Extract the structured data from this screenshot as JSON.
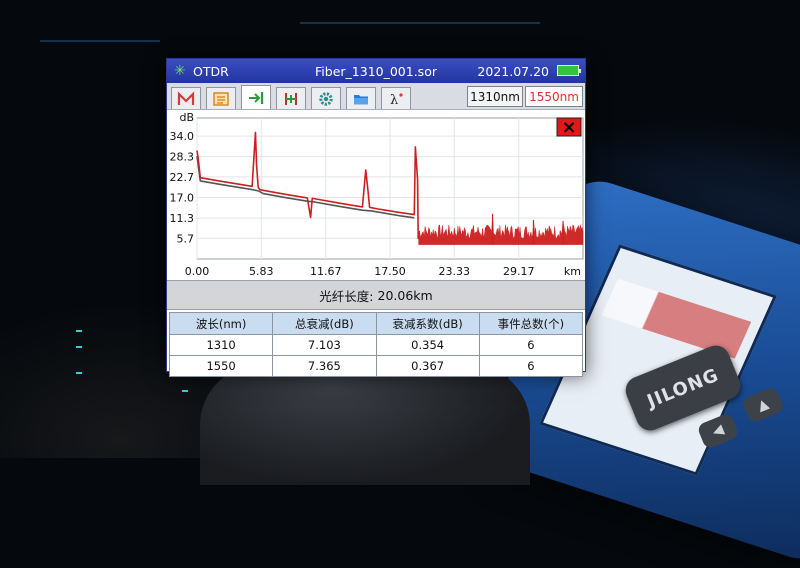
{
  "window": {
    "app_name": "OTDR",
    "file_name": "Fiber_1310_001.sor",
    "date": "2021.07.20",
    "battery_color": "#35c43a",
    "app_icon": "sun-star-icon"
  },
  "toolbar": {
    "tools": [
      {
        "name": "marker-m-icon",
        "color": "#d63a3a"
      },
      {
        "name": "event-list-icon",
        "color": "#d98a1e"
      },
      {
        "name": "arrow-bar-icon",
        "color": "#2c9a3c"
      },
      {
        "name": "cursor-bars-icon",
        "color": "#c03030"
      },
      {
        "name": "settings-gear-icon",
        "color": "#2c8c8c"
      },
      {
        "name": "folder-icon",
        "color": "#2b7bd0"
      },
      {
        "name": "lambda-icon",
        "color": "#222222"
      }
    ],
    "active_tool_index": 2,
    "wavelength_1": "1310nm",
    "wavelength_2": "1550nm",
    "wavelength_2_color": "#e03030"
  },
  "chart_data": {
    "type": "line",
    "ylabel": "dB",
    "xlabel": "km",
    "y_ticks": [
      "34.0",
      "28.3",
      "22.7",
      "17.0",
      "11.3",
      "5.7"
    ],
    "y_tick_values": [
      34.0,
      28.3,
      22.7,
      17.0,
      11.3,
      5.7
    ],
    "x_ticks": [
      "0.00",
      "5.83",
      "11.67",
      "17.50",
      "23.33",
      "29.17"
    ],
    "x_tick_values": [
      0.0,
      5.83,
      11.67,
      17.5,
      23.33,
      29.17
    ],
    "xlim": [
      0,
      35
    ],
    "ylim": [
      0,
      39
    ],
    "grid": true,
    "close_button": "×",
    "series": [
      {
        "color": "#cc1f1f",
        "x": [
          0,
          0.1,
          0.3,
          2.0,
          4.0,
          5.0,
          5.3,
          5.4,
          5.55,
          5.7,
          6.0,
          8.0,
          10.0,
          10.3,
          10.45,
          10.6,
          10.8,
          13.0,
          15.0,
          15.3,
          15.5,
          15.65,
          15.8,
          16.5,
          18.5,
          19.7,
          19.8,
          20.0,
          20.06
        ],
        "y": [
          30.0,
          28.0,
          22.5,
          21.6,
          20.6,
          20.1,
          35.0,
          26.0,
          19.8,
          19.2,
          19.0,
          17.9,
          16.9,
          11.5,
          16.8,
          16.7,
          16.6,
          15.4,
          14.4,
          24.6,
          19.0,
          14.3,
          14.2,
          13.8,
          12.8,
          12.3,
          31.0,
          22.0,
          5.5
        ]
      },
      {
        "color": "#555555",
        "x": [
          0,
          0.3,
          2.0,
          4.0,
          5.0,
          5.6,
          6.0,
          8.0,
          10.0,
          10.6,
          13.0,
          15.0,
          15.8,
          18.5,
          19.7
        ],
        "y": [
          28.5,
          21.6,
          20.7,
          19.7,
          19.2,
          18.8,
          18.1,
          17.0,
          16.0,
          15.8,
          14.5,
          13.5,
          13.3,
          11.9,
          11.4
        ]
      }
    ],
    "noise_series": {
      "color": "#cc1f1f",
      "x_start": 20.1,
      "x_end": 35.0,
      "floor": 4.0,
      "level_min": 5.5,
      "level_max": 9.5,
      "spikes": [
        {
          "x": 26.8,
          "y": 12.5
        },
        {
          "x": 30.5,
          "y": 10.8
        },
        {
          "x": 33.2,
          "y": 10.5
        }
      ]
    }
  },
  "summary": {
    "label": "光纤长度:",
    "value": "20.06km"
  },
  "results_table": {
    "headers": [
      "波长(nm)",
      "总衰减(dB)",
      "衰减系数(dB)",
      "事件总数(个)"
    ],
    "rows": [
      [
        "1310",
        "7.103",
        "0.354",
        "6"
      ],
      [
        "1550",
        "7.365",
        "0.367",
        "6"
      ]
    ]
  },
  "device": {
    "logo": "JILONG"
  }
}
